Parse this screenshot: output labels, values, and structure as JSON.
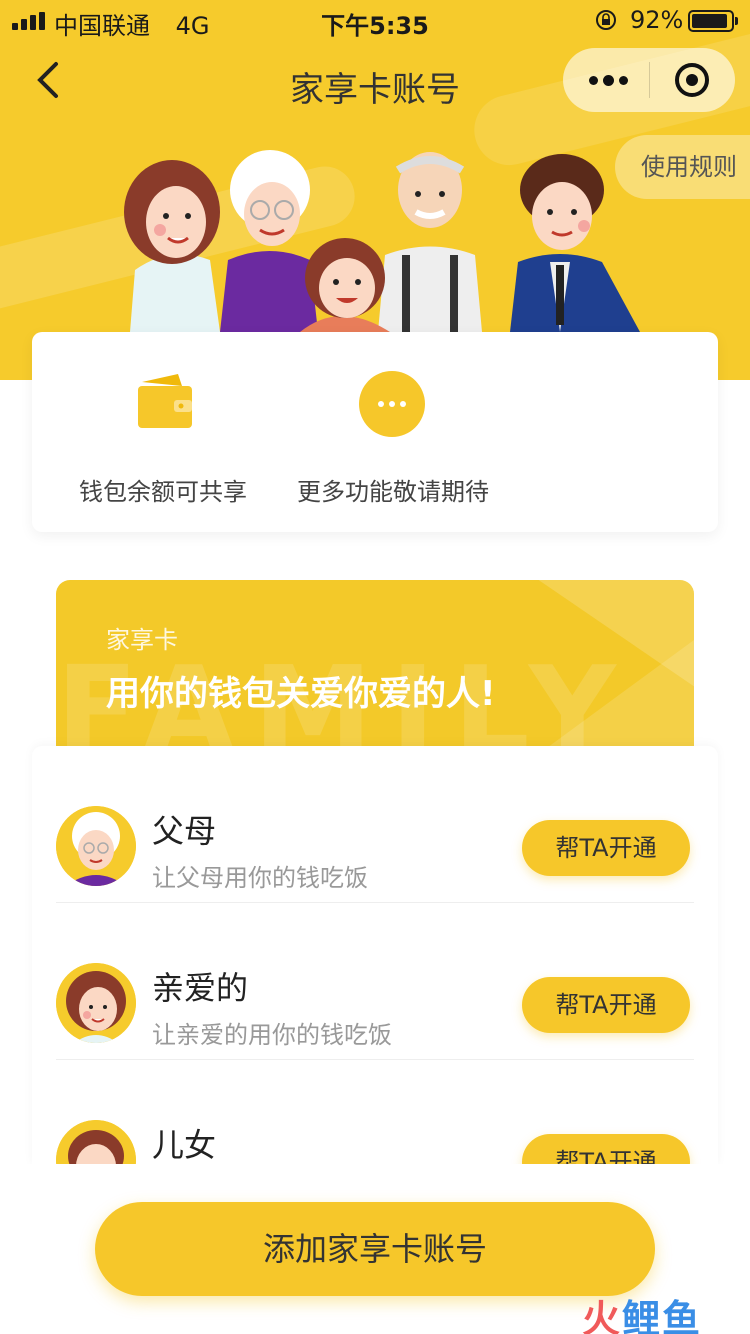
{
  "status_bar": {
    "carrier": "中国联通",
    "network": "4G",
    "time": "下午5:35",
    "battery_percent": "92%",
    "battery_level": 0.92
  },
  "nav": {
    "title": "家享卡账号",
    "back_icon": "chevron-left-icon",
    "more_icon": "more-dots-icon",
    "close_icon": "target-icon"
  },
  "hero": {
    "rules_label": "使用规则"
  },
  "features": [
    {
      "label": "钱包余额可共享",
      "icon": "wallet-icon"
    },
    {
      "label": "更多功能敬请期待",
      "icon": "more-dots-icon"
    }
  ],
  "banner": {
    "subtitle": "家享卡",
    "title": "用你的钱包关爱你爱的人!",
    "watermark": "FAMILY"
  },
  "members": [
    {
      "name": "父母",
      "desc": "让父母用你的钱吃饭",
      "button": "帮TA开通"
    },
    {
      "name": "亲爱的",
      "desc": "让亲爱的用你的钱吃饭",
      "button": "帮TA开通"
    },
    {
      "name": "儿女",
      "desc": "",
      "button": "帮TA开通"
    }
  ],
  "bottom": {
    "add_button": "添加家享卡账号",
    "logo_part1": "火",
    "logo_part2": "鲤鱼"
  },
  "colors": {
    "brand_yellow": "#f6cb2c",
    "button_yellow": "#f6c72a"
  }
}
